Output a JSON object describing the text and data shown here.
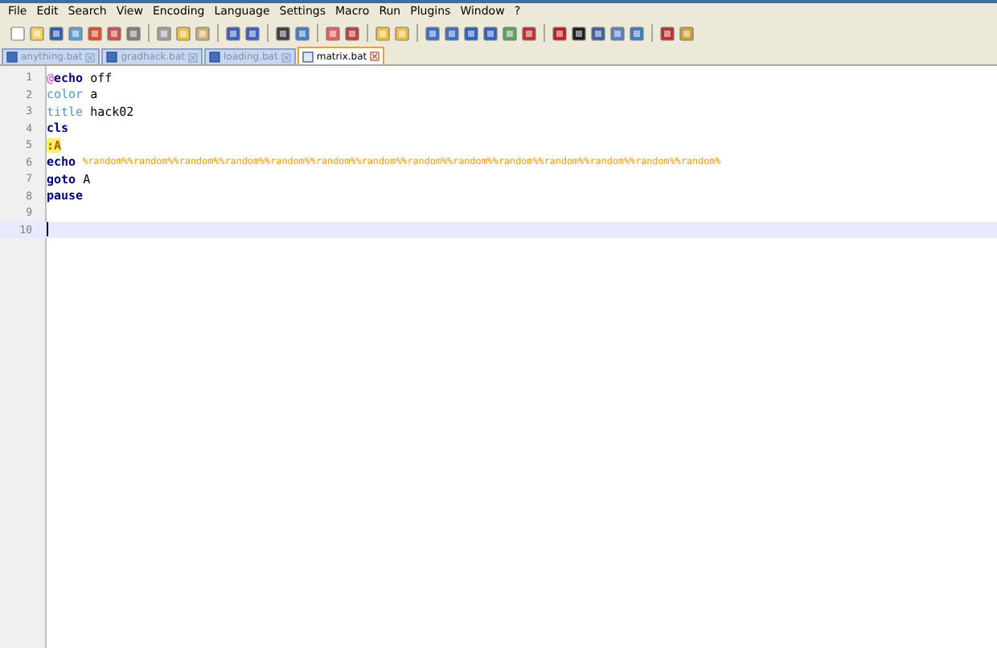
{
  "menu": [
    "File",
    "Edit",
    "Search",
    "View",
    "Encoding",
    "Language",
    "Settings",
    "Macro",
    "Run",
    "Plugins",
    "Window",
    "?"
  ],
  "tabs": [
    {
      "label": "anything.bat",
      "selected": false
    },
    {
      "label": "gradhack.bat",
      "selected": false
    },
    {
      "label": "loading.bat",
      "selected": false
    },
    {
      "label": "matrix.bat",
      "selected": true
    }
  ],
  "lines": [
    {
      "number": "1",
      "current": false,
      "tokens": [
        {
          "kind": "at",
          "text": "@"
        },
        {
          "kind": "keyword",
          "text": "echo"
        },
        {
          "kind": "plain",
          "text": " off"
        }
      ]
    },
    {
      "number": "2",
      "current": false,
      "tokens": [
        {
          "kind": "command",
          "text": "color"
        },
        {
          "kind": "plain",
          "text": " a"
        }
      ]
    },
    {
      "number": "3",
      "current": false,
      "tokens": [
        {
          "kind": "command",
          "text": "title"
        },
        {
          "kind": "plain",
          "text": " hack02"
        }
      ]
    },
    {
      "number": "4",
      "current": false,
      "tokens": [
        {
          "kind": "keyword",
          "text": "cls"
        }
      ]
    },
    {
      "number": "5",
      "current": false,
      "tokens": [
        {
          "kind": "label",
          "text": ":A"
        }
      ]
    },
    {
      "number": "6",
      "current": false,
      "tokens": [
        {
          "kind": "keyword",
          "text": "echo"
        },
        {
          "kind": "variable",
          "text": "%random%%random%%random%%random%%random%%random%%random%%random%%random%%random%%random%%random%%random%%random%"
        }
      ]
    },
    {
      "number": "7",
      "current": false,
      "tokens": [
        {
          "kind": "keyword",
          "text": "goto"
        },
        {
          "kind": "plain",
          "text": " A"
        }
      ]
    },
    {
      "number": "8",
      "current": false,
      "tokens": [
        {
          "kind": "keyword",
          "text": "pause"
        }
      ]
    },
    {
      "number": "9",
      "current": false
    },
    {
      "number": "10",
      "current": true
    }
  ]
}
